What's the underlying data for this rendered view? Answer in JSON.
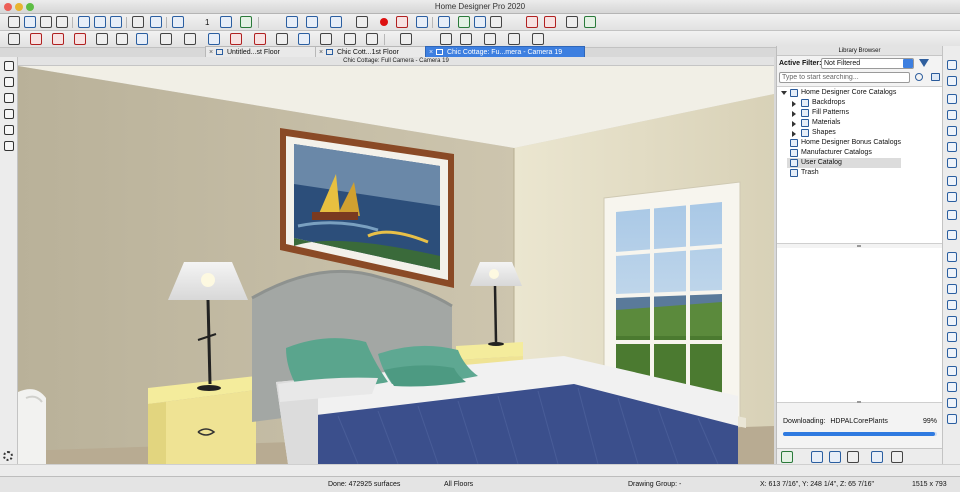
{
  "window": {
    "title": "Home Designer Pro 2020"
  },
  "tabs": [
    {
      "label": "Untitled...st Floor",
      "active": false
    },
    {
      "label": "Chic Cott...1st Floor",
      "active": false
    },
    {
      "label": "Chic Cottage: Fu...mera - Camera 19",
      "active": true
    }
  ],
  "toolbar": {
    "floor_number": "1"
  },
  "view": {
    "title": "Chic Cottage: Full Camera - Camera 19"
  },
  "library": {
    "header": "Library Browser",
    "filter_label": "Active Filter:",
    "filter_value": "Not Filtered",
    "search_placeholder": "Type to start searching...",
    "tree": [
      {
        "label": "Home Designer Core Catalogs",
        "level": 0,
        "expanded": true
      },
      {
        "label": "Backdrops",
        "level": 1,
        "expanded": false
      },
      {
        "label": "Fill Patterns",
        "level": 1,
        "expanded": false
      },
      {
        "label": "Materials",
        "level": 1,
        "expanded": false
      },
      {
        "label": "Shapes",
        "level": 1,
        "expanded": false
      },
      {
        "label": "Home Designer Bonus Catalogs",
        "level": 0
      },
      {
        "label": "Manufacturer Catalogs",
        "level": 0
      },
      {
        "label": "User Catalog",
        "level": 0,
        "selected": true
      },
      {
        "label": "Trash",
        "level": 0
      }
    ],
    "download": {
      "label": "Downloading:",
      "item": "HDPALCorePlants",
      "percent_text": "99%",
      "progress": 0.99
    }
  },
  "status": {
    "done": "Done:  472925 surfaces",
    "floors": "All Floors",
    "drawing_group": "Drawing Group: -",
    "coordinates": "X: 613 7/16\", Y: 248 1/4\", Z: 65 7/16\"",
    "size": "1515 x 793"
  },
  "colors": {
    "accent": "#3d7fe0",
    "wall_left": "#c9c1a8",
    "wall_right": "#e7e1c9",
    "bedspread": "#3b4f8c",
    "pillow": "#5aa58d",
    "nightstand": "#f0e6a0"
  }
}
